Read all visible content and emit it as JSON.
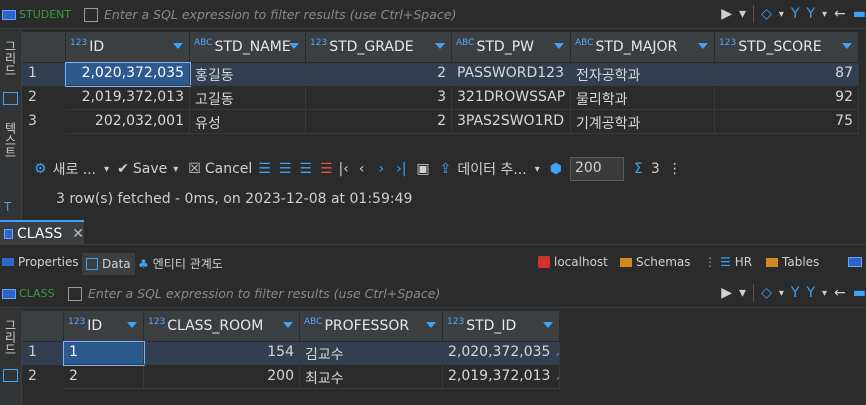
{
  "top": {
    "filter": {
      "table_name": "STUDENT",
      "placeholder": "Enter a SQL expression to filter results (use Ctrl+Space)"
    },
    "side_tabs": {
      "grid": "그리드",
      "text": "텍스트"
    },
    "columns": [
      {
        "type": "123",
        "name": "ID"
      },
      {
        "type": "ABC",
        "name": "STD_NAME"
      },
      {
        "type": "123",
        "name": "STD_GRADE"
      },
      {
        "type": "ABC",
        "name": "STD_PW"
      },
      {
        "type": "ABC",
        "name": "STD_MAJOR"
      },
      {
        "type": "123",
        "name": "STD_SCORE"
      }
    ],
    "rows": [
      {
        "num": "1",
        "cells": [
          "2,020,372,035",
          "홍길동",
          "2",
          "PASSWORD123",
          "전자공학과",
          "87"
        ]
      },
      {
        "num": "2",
        "cells": [
          "2,019,372,013",
          "고길동",
          "3",
          "321DROWSSAP",
          "물리학과",
          "92"
        ]
      },
      {
        "num": "3",
        "cells": [
          "202,032,001",
          "유성",
          "2",
          "3PAS2SWO1RD",
          "기계공학과",
          "75"
        ]
      }
    ],
    "toolbar": {
      "new_label": "새로 ...",
      "save_label": "Save",
      "cancel_label": "Cancel",
      "export_label": "데이터 추...",
      "fetch_size": "200",
      "count": "3"
    },
    "status": "3 row(s) fetched - 0ms, on 2023-12-08 at 01:59:49"
  },
  "editor_tab": {
    "label": "CLASS"
  },
  "subtabs": {
    "properties": "Properties",
    "data": "Data",
    "er": "엔티티 관계도",
    "connection": "localhost",
    "schemas": "Schemas",
    "hr": "HR",
    "tables": "Tables"
  },
  "bottom": {
    "filter": {
      "table_name": "CLASS",
      "placeholder": "Enter a SQL expression to filter results (use Ctrl+Space)"
    },
    "side_tabs": {
      "grid": "그리드"
    },
    "columns": [
      {
        "type": "123",
        "name": "ID"
      },
      {
        "type": "123",
        "name": "CLASS_ROOM"
      },
      {
        "type": "ABC",
        "name": "PROFESSOR"
      },
      {
        "type": "123",
        "name": "STD_ID"
      }
    ],
    "rows": [
      {
        "num": "1",
        "cells": [
          "1",
          "154",
          "김교수",
          "2,020,372,035"
        ]
      },
      {
        "num": "2",
        "cells": [
          "2",
          "200",
          "최교수",
          "2,019,372,013"
        ]
      }
    ]
  }
}
